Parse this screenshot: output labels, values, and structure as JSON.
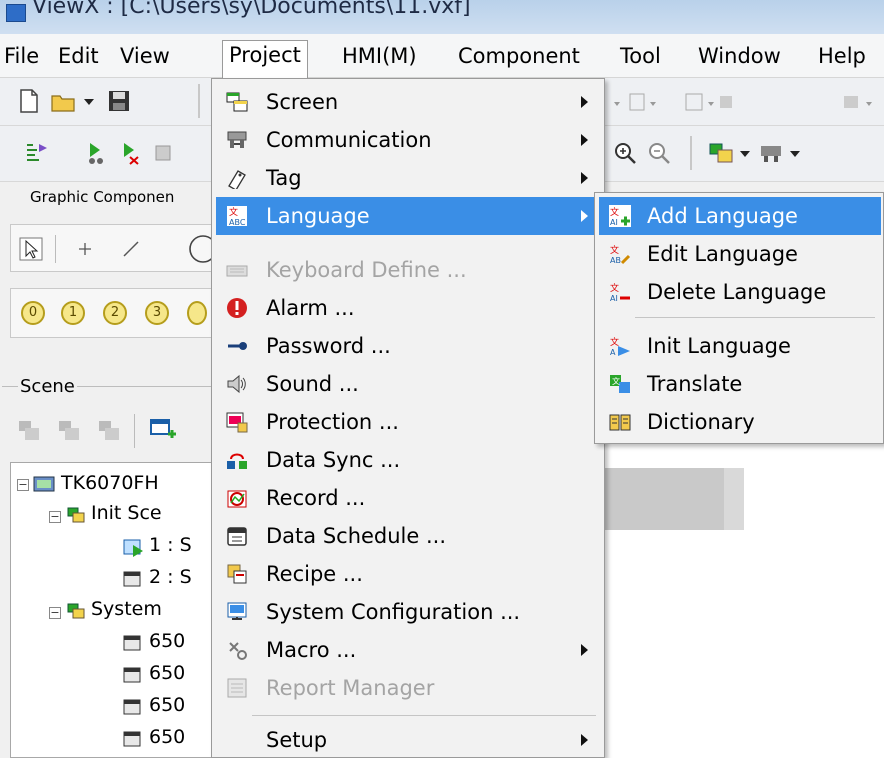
{
  "window": {
    "title": "ViewX : [C:\\Users\\sy\\Documents\\11.vxf]"
  },
  "menubar": {
    "items": [
      "File",
      "Edit",
      "View",
      "Project",
      "HMI(M)",
      "Component",
      "Tool",
      "Window",
      "Help"
    ]
  },
  "panel": {
    "graphic_label": "Graphic Componen",
    "numbers": [
      "0",
      "1",
      "2",
      "3"
    ],
    "scene_label": "Scene"
  },
  "tree": {
    "root": "TK6070FH",
    "init_scene": "Init Sce",
    "screen1": "1 : S",
    "screen2": "2 : S",
    "system": "System",
    "sys1": "650",
    "sys2": "650",
    "sys3": "650",
    "sys4": "650"
  },
  "canvas": {
    "button_text": ""
  },
  "project_menu": {
    "items": [
      {
        "label": "Screen",
        "icon": "screen-icon",
        "submenu": true
      },
      {
        "label": "Communication",
        "icon": "communication-icon",
        "submenu": true
      },
      {
        "label": "Tag",
        "icon": "tag-icon",
        "submenu": true
      },
      {
        "label": "Language",
        "icon": "language-icon",
        "submenu": true,
        "highlighted": true
      },
      {
        "label": "Keyboard Define ...",
        "icon": "keyboard-icon",
        "disabled": true
      },
      {
        "label": "Alarm ...",
        "icon": "alarm-icon"
      },
      {
        "label": "Password ...",
        "icon": "key-icon"
      },
      {
        "label": "Sound ...",
        "icon": "speaker-icon"
      },
      {
        "label": "Protection ...",
        "icon": "protection-icon"
      },
      {
        "label": "Data Sync ...",
        "icon": "data-sync-icon"
      },
      {
        "label": "Record ...",
        "icon": "record-icon"
      },
      {
        "label": "Data Schedule ...",
        "icon": "schedule-icon"
      },
      {
        "label": "Recipe ...",
        "icon": "recipe-icon"
      },
      {
        "label": "System Configuration ...",
        "icon": "system-config-icon"
      },
      {
        "label": "Macro ...",
        "icon": "macro-icon",
        "submenu": true
      },
      {
        "label": "Report Manager",
        "icon": "report-icon",
        "disabled": true
      },
      {
        "label": "Setup",
        "icon": "",
        "submenu": true
      }
    ]
  },
  "language_menu": {
    "items": [
      {
        "label": "Add Language",
        "highlighted": true
      },
      {
        "label": "Edit Language"
      },
      {
        "label": "Delete Language"
      },
      {
        "label": "Init Language"
      },
      {
        "label": "Translate"
      },
      {
        "label": "Dictionary"
      }
    ]
  },
  "colors": {
    "highlight": "#3a8ee6",
    "disabled": "#a4a4a4"
  }
}
